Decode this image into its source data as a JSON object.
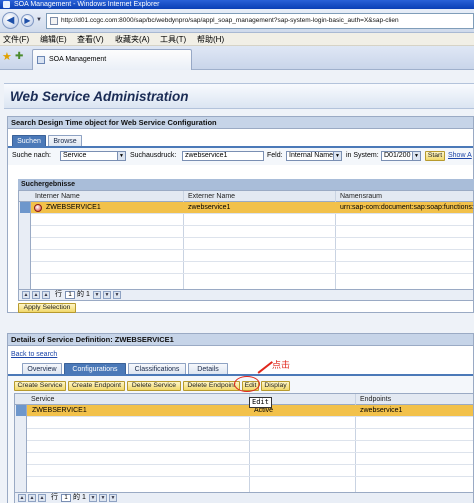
{
  "window": {
    "title": "SOA Management - Windows Internet Explorer"
  },
  "address_bar": {
    "url": "http://d01.ccgc.com:8000/sap/bc/webdynpro/sap/appl_soap_management?sap-system-login-basic_auth=X&sap-clien"
  },
  "menu": {
    "items": [
      "文件(F)",
      "编辑(E)",
      "查看(V)",
      "收藏夹(A)",
      "工具(T)",
      "帮助(H)"
    ]
  },
  "browser_tab": {
    "label": "SOA Management"
  },
  "page": {
    "title": "Web Service Administration"
  },
  "search_panel": {
    "header": "Search Design Time object for Web Service Configuration",
    "tabs": [
      "Suchen",
      "Browse"
    ],
    "active_tab": 0,
    "search_in_label": "Suche nach:",
    "search_in_value": "Service",
    "expression_label": "Suchausdruck:",
    "expression_value": "zwebservice1",
    "field_label": "Feld:",
    "field_value": "Internal Name",
    "system_label": "in System:",
    "system_value": "D01/200",
    "start_button": "Start",
    "show_link": "Show A",
    "results_header": "Suchergebnisse",
    "columns": [
      "Interner Name",
      "Externer Name",
      "Namensraum"
    ],
    "rows": [
      {
        "internal": "ZWEBSERVICE1",
        "external": "zwebservice1",
        "namespace": "urn:sap-com:document:sap:soap:functions:",
        "selected": true
      }
    ],
    "pager": {
      "row_label": "行",
      "current": "1",
      "of_label": "的",
      "total": "1"
    },
    "apply_button": "Apply Selection"
  },
  "details_panel": {
    "header": "Details of Service Definition: ZWEBSERVICE1",
    "back_link": "Back to search",
    "tabs": [
      "Overview",
      "Configurations",
      "Classifications",
      "Details"
    ],
    "active_tab": 1,
    "toolbar": [
      "Create Service",
      "Create Endpoint",
      "Delete Service",
      "Delete Endpoint",
      "Edit",
      "Display"
    ],
    "columns": [
      "Service",
      "",
      "Endpoints"
    ],
    "rows": [
      {
        "service": "ZWEBSERVICE1",
        "status": "Active",
        "endpoints": "zwebservice1",
        "selected": true
      }
    ],
    "pager": {
      "row_label": "行",
      "current": "1",
      "of_label": "的",
      "total": "1"
    }
  },
  "annotation": {
    "label": "点击",
    "tooltip": "Edit",
    "color": "#e0261b"
  },
  "colors": {
    "title_bar": "#0a3fb5",
    "active_tab": "#4b79b8",
    "selected_row": "#f2c14a",
    "button": "#f1d86a"
  }
}
